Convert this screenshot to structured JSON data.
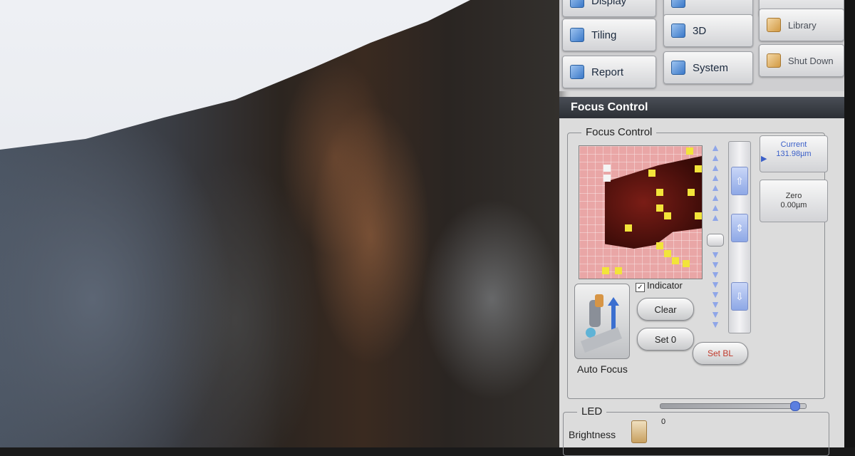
{
  "menu": {
    "display": "Display",
    "tiling": "Tiling",
    "three_d": "3D",
    "library": "Library",
    "report": "Report",
    "system": "System",
    "shut_down": "Shut Down"
  },
  "panel": {
    "title": "Focus Control",
    "group_title": "Focus Control",
    "indicator_label": "Indicator",
    "indicator_checked": true,
    "clear_label": "Clear",
    "set0_label": "Set 0",
    "setbl_label": "Set BL",
    "auto_focus_label": "Auto Focus",
    "current_label": "Current",
    "current_value": "131.98µm",
    "zero_label": "Zero",
    "zero_value": "0.00µm"
  },
  "led": {
    "group_title": "LED",
    "brightness_label": "Brightness",
    "slider_min": "0",
    "brightness_level": 0.95
  },
  "colors": {
    "accent": "#3a78c8",
    "indicator_yellow": "#f2e43a",
    "setbl_text": "#c0392b"
  },
  "icons": [
    "display-icon",
    "tiling-icon",
    "3d-icon",
    "library-icon",
    "report-icon",
    "system-icon",
    "shut-down-icon",
    "auto-focus-icon"
  ]
}
